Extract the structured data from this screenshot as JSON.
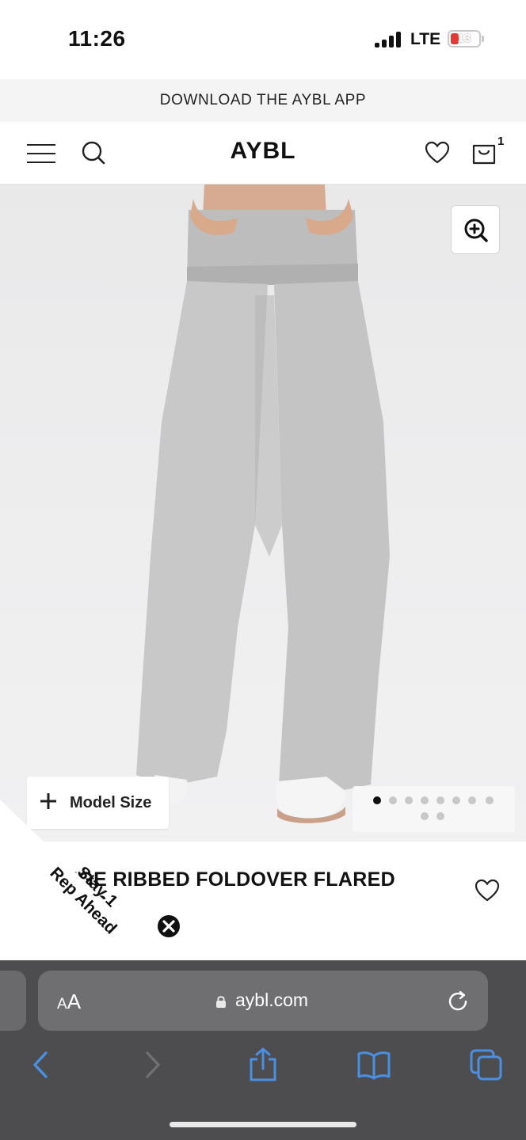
{
  "status_bar": {
    "time": "11:26",
    "network": "LTE",
    "battery_level": "13",
    "battery_color": "#e53935"
  },
  "promo_banner": {
    "text": "DOWNLOAD THE AYBL APP"
  },
  "header": {
    "logo": "AYBL",
    "cart_count": "1",
    "icons": [
      "menu-icon",
      "search-icon",
      "heart-icon",
      "bag-icon"
    ]
  },
  "product": {
    "title_visible": "NGE RIBBED FOLDOVER FLARED\n   NGS",
    "model_size_label": "Model Size",
    "image_count": 10,
    "active_image_index": 0,
    "icons": [
      "zoom-in-icon",
      "plus-icon",
      "heart-icon"
    ]
  },
  "ribbon": {
    "line1": "Stay 1",
    "line2": "Rep Ahead",
    "icons": [
      "close-icon"
    ]
  },
  "browser": {
    "text_size_small": "A",
    "text_size_large": "A",
    "url": "aybl.com",
    "icons": [
      "lock-icon",
      "reload-icon",
      "back-icon",
      "forward-icon",
      "share-icon",
      "bookmarks-icon",
      "tabs-icon"
    ],
    "accent_color": "#4a90e2"
  }
}
